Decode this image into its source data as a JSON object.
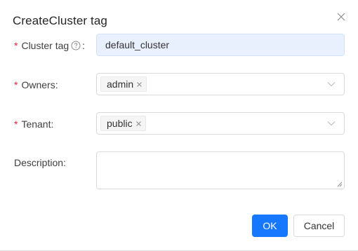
{
  "dialog": {
    "title": "CreateCluster tag"
  },
  "form": {
    "required_marker": "*",
    "cluster_tag": {
      "label": "Cluster tag",
      "colon": ":",
      "value": "default_cluster"
    },
    "owners": {
      "label": "Owners:",
      "tags": [
        "admin"
      ]
    },
    "tenant": {
      "label": "Tenant:",
      "tags": [
        "public"
      ]
    },
    "description": {
      "label": "Description:",
      "value": ""
    }
  },
  "footer": {
    "ok_label": "OK",
    "cancel_label": "Cancel"
  },
  "colors": {
    "primary": "#1677ff",
    "required": "#f5222d",
    "autofill_bg": "#e8f0fe"
  },
  "icons": {
    "close": "close-icon",
    "help": "question-circle-icon",
    "chevron": "chevron-down-icon",
    "tag_remove": "close-small-icon",
    "resize": "resize-handle-icon"
  }
}
